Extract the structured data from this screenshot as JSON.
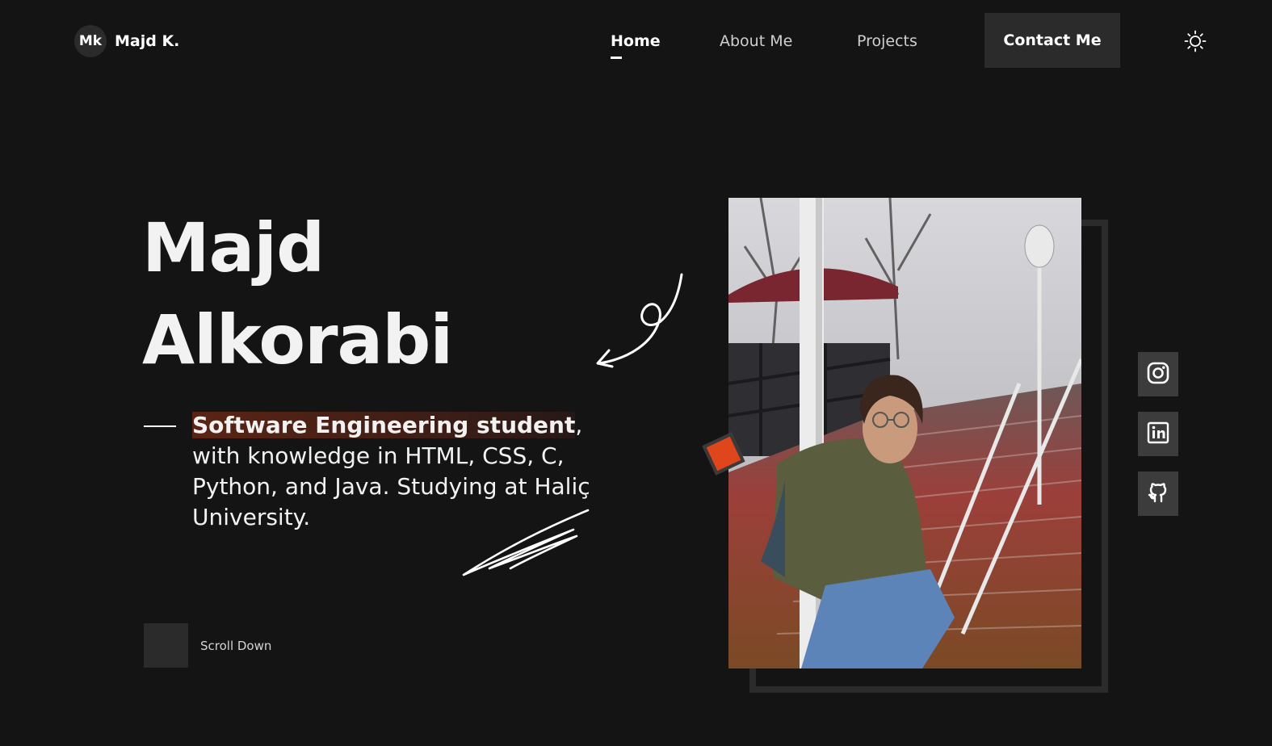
{
  "brand": {
    "initials": "Mk",
    "name": "Majd K."
  },
  "nav": {
    "items": [
      {
        "label": "Home",
        "active": true
      },
      {
        "label": "About Me",
        "active": false
      },
      {
        "label": "Projects",
        "active": false
      }
    ],
    "contact_label": "Contact Me",
    "theme_icon": "sun-icon"
  },
  "hero": {
    "first_name": "Majd",
    "last_name": "Alkorabi",
    "highlight": "Software Engineering student",
    "description_rest": ", with knowledge in HTML, CSS, C, Python, and Java. Studying at Haliç University.",
    "scroll_label": "Scroll Down"
  },
  "social": [
    {
      "icon": "instagram-icon"
    },
    {
      "icon": "linkedin-icon"
    },
    {
      "icon": "github-icon"
    }
  ],
  "colors": {
    "background": "#141414",
    "panel": "#2b2b2b",
    "accent": "#e0461c",
    "highlight": "#5a2414"
  }
}
